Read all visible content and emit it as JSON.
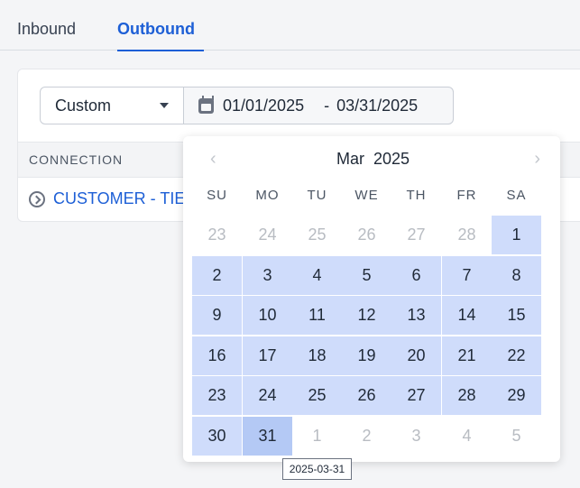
{
  "tabs": [
    {
      "label": "Inbound",
      "active": false
    },
    {
      "label": "Outbound",
      "active": true
    }
  ],
  "filter": {
    "range_type": "Custom",
    "start_date": "01/01/2025",
    "separator": "-",
    "end_date": "03/31/2025"
  },
  "table": {
    "column_header": "CONNECTION",
    "row_text": "CUSTOMER - TIE"
  },
  "calendar": {
    "month": "Mar",
    "year": "2025",
    "prev_symbol": "‹",
    "next_symbol": "›",
    "weekdays": [
      "SU",
      "MO",
      "TU",
      "WE",
      "TH",
      "FR",
      "SA"
    ],
    "weeks": [
      [
        {
          "d": "23",
          "o": true
        },
        {
          "d": "24",
          "o": true
        },
        {
          "d": "25",
          "o": true
        },
        {
          "d": "26",
          "o": true
        },
        {
          "d": "27",
          "o": true
        },
        {
          "d": "28",
          "o": true
        },
        {
          "d": "1",
          "r": true
        }
      ],
      [
        {
          "d": "2",
          "r": true
        },
        {
          "d": "3",
          "r": true
        },
        {
          "d": "4",
          "r": true
        },
        {
          "d": "5",
          "r": true
        },
        {
          "d": "6",
          "r": true
        },
        {
          "d": "7",
          "r": true
        },
        {
          "d": "8",
          "r": true
        }
      ],
      [
        {
          "d": "9",
          "r": true
        },
        {
          "d": "10",
          "r": true
        },
        {
          "d": "11",
          "r": true
        },
        {
          "d": "12",
          "r": true
        },
        {
          "d": "13",
          "r": true
        },
        {
          "d": "14",
          "r": true
        },
        {
          "d": "15",
          "r": true
        }
      ],
      [
        {
          "d": "16",
          "r": true
        },
        {
          "d": "17",
          "r": true
        },
        {
          "d": "18",
          "r": true
        },
        {
          "d": "19",
          "r": true
        },
        {
          "d": "20",
          "r": true
        },
        {
          "d": "21",
          "r": true
        },
        {
          "d": "22",
          "r": true
        }
      ],
      [
        {
          "d": "23",
          "r": true
        },
        {
          "d": "24",
          "r": true
        },
        {
          "d": "25",
          "r": true
        },
        {
          "d": "26",
          "r": true
        },
        {
          "d": "27",
          "r": true
        },
        {
          "d": "28",
          "r": true
        },
        {
          "d": "29",
          "r": true
        }
      ],
      [
        {
          "d": "30",
          "r": true
        },
        {
          "d": "31",
          "r": true,
          "end": true
        },
        {
          "d": "1",
          "o": true
        },
        {
          "d": "2",
          "o": true
        },
        {
          "d": "3",
          "o": true
        },
        {
          "d": "4",
          "o": true
        },
        {
          "d": "5",
          "o": true
        }
      ]
    ]
  },
  "tooltip": "2025-03-31",
  "colors": {
    "accent": "#1d5fd6",
    "range": "#cfdcfb",
    "range_end": "#b4c9f5"
  },
  "icons": {
    "date_field": "calendar-icon",
    "row_toggle": "expand-circle-icon",
    "select": "caret-down-icon"
  }
}
